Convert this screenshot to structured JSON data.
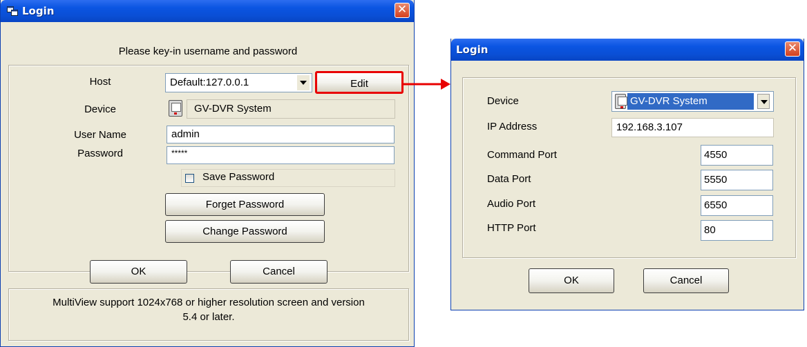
{
  "login_window": {
    "title": "Login",
    "close_glyph": "✕",
    "header_text": "Please key-in username and password",
    "host": {
      "label": "Host",
      "value": "Default:127.0.0.1",
      "edit_button": "Edit"
    },
    "device": {
      "label": "Device",
      "value": "GV-DVR System",
      "icon": "dvr-device-icon"
    },
    "user_name": {
      "label": "User Name",
      "value": "admin"
    },
    "password": {
      "label": "Password",
      "value": "*****"
    },
    "save_password": {
      "label": "Save Password",
      "checked": false
    },
    "forget_password_button": "Forget Password",
    "change_password_button": "Change Password",
    "ok_button": "OK",
    "cancel_button": "Cancel",
    "footer_note": "MultiView support 1024x768 or higher resolution screen and version 5.4 or later."
  },
  "device_login_window": {
    "title": "Login",
    "close_glyph": "✕",
    "device": {
      "label": "Device",
      "value": "GV-DVR System",
      "icon": "dvr-device-icon"
    },
    "ip_address": {
      "label": "IP Address",
      "value": "192.168.3.107"
    },
    "command_port": {
      "label": "Command Port",
      "value": "4550"
    },
    "data_port": {
      "label": "Data Port",
      "value": "5550"
    },
    "audio_port": {
      "label": "Audio Port",
      "value": "6550"
    },
    "http_port": {
      "label": "HTTP Port",
      "value": "80"
    },
    "ok_button": "OK",
    "cancel_button": "Cancel"
  },
  "colors": {
    "title_bar": "#0a4fd6",
    "close_button": "#d4401f",
    "highlight_box": "#e80000",
    "selection": "#316ac5",
    "dialog_face": "#ece9d8"
  }
}
